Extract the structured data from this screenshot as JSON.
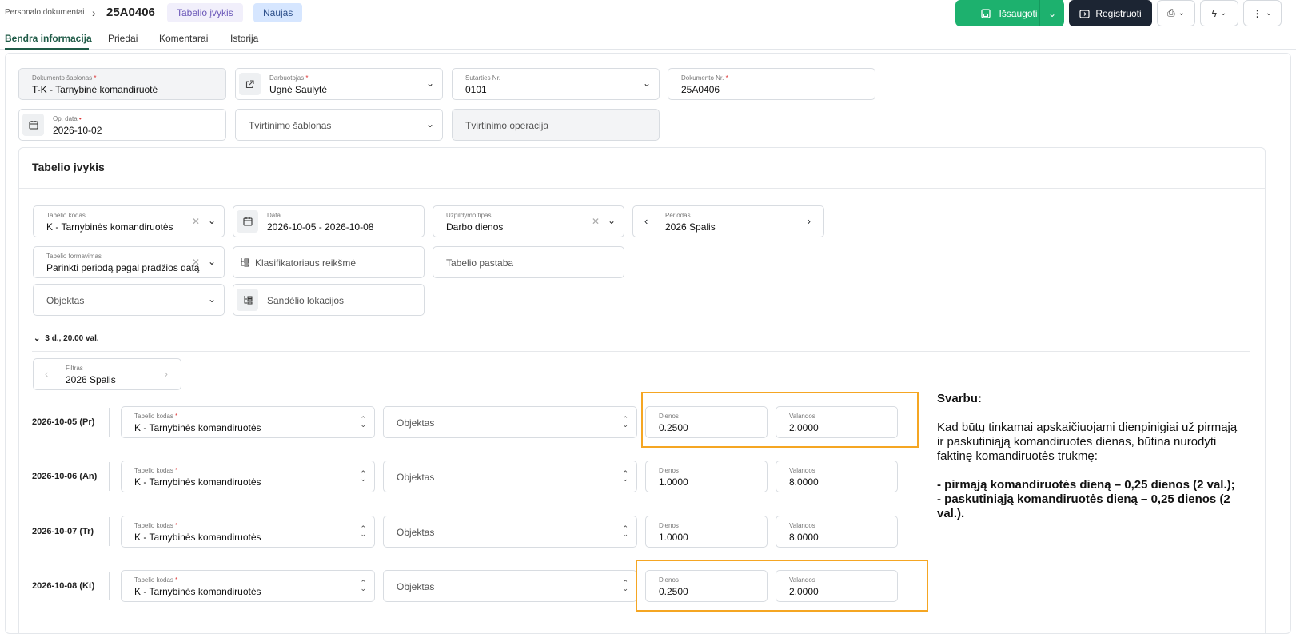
{
  "header": {
    "breadcrumb": "Personalo dokumentai",
    "doc_number": "25A0406",
    "badge_type": "Tabelio įvykis",
    "badge_status": "Naujas",
    "save_label": "Išsaugoti",
    "register_label": "Registruoti"
  },
  "tabs": [
    "Bendra informacija",
    "Priedai",
    "Komentarai",
    "Istorija"
  ],
  "form": {
    "template": {
      "label": "Dokumento šablonas",
      "value": "T-K - Tarnybinė komandiruotė"
    },
    "employee": {
      "label": "Darbuotojas",
      "value": "Ugnė Saulytė"
    },
    "contract": {
      "label": "Sutarties Nr.",
      "value": "0101"
    },
    "doc_no": {
      "label": "Dokumento Nr.",
      "value": "25A0406"
    },
    "op_date": {
      "label": "Op. data",
      "value": "2026-10-02"
    },
    "confirm_template": {
      "placeholder": "Tvirtinimo šablonas"
    },
    "confirm_operation": {
      "placeholder": "Tvirtinimo operacija"
    }
  },
  "section": {
    "title": "Tabelio įvykis",
    "tabel_code": {
      "label": "Tabelio kodas",
      "value": "K - Tarnybinės komandiruotės"
    },
    "date": {
      "label": "Data",
      "value": "2026-10-05 - 2026-10-08"
    },
    "fill_type": {
      "label": "Užpildymo tipas",
      "value": "Darbo dienos"
    },
    "period": {
      "label": "Periodas",
      "value": "2026 Spalis"
    },
    "formation": {
      "label": "Tabelio formavimas",
      "value": "Parinkti periodą pagal pradžios datą"
    },
    "classifier": {
      "placeholder": "Klasifikatoriaus reikšmė"
    },
    "note": {
      "placeholder": "Tabelio pastaba"
    },
    "object": {
      "placeholder": "Objektas"
    },
    "warehouse": {
      "placeholder": "Sandėlio lokacijos"
    },
    "summary": "3 d., 20.00 val.",
    "filter": {
      "label": "Filtras",
      "value": "2026 Spalis"
    }
  },
  "rows": [
    {
      "date": "2026-10-05 (Pr)",
      "code_label": "Tabelio kodas",
      "code": "K - Tarnybinės komandiruotės",
      "object": "Objektas",
      "days_label": "Dienos",
      "days": "0.2500",
      "hours_label": "Valandos",
      "hours": "2.0000"
    },
    {
      "date": "2026-10-06 (An)",
      "code_label": "Tabelio kodas",
      "code": "K - Tarnybinės komandiruotės",
      "object": "Objektas",
      "days_label": "Dienos",
      "days": "1.0000",
      "hours_label": "Valandos",
      "hours": "8.0000"
    },
    {
      "date": "2026-10-07 (Tr)",
      "code_label": "Tabelio kodas",
      "code": "K - Tarnybinės komandiruotės",
      "object": "Objektas",
      "days_label": "Dienos",
      "days": "1.0000",
      "hours_label": "Valandos",
      "hours": "8.0000"
    },
    {
      "date": "2026-10-08 (Kt)",
      "code_label": "Tabelio kodas",
      "code": "K - Tarnybinės komandiruotės",
      "object": "Objektas",
      "days_label": "Dienos",
      "days": "0.2500",
      "hours_label": "Valandos",
      "hours": "2.0000"
    }
  ],
  "annotation": {
    "title": "Svarbu:",
    "body": "Kad būtų tinkamai apskaičiuojami dienpinigiai už pirmąją ir paskutiniąją komandiruotės dienas, būtina nurodyti faktinę komandiruotės trukmę:",
    "item1": "- pirmąją komandiruotės dieną – 0,25 dienos (2 val.);",
    "item2": "- paskutiniąją komandiruotės dieną – 0,25 dienos (2 val.)."
  },
  "colors": {
    "accent_green": "#1db16e",
    "dark": "#1c2533",
    "highlight": "#f5a623"
  }
}
